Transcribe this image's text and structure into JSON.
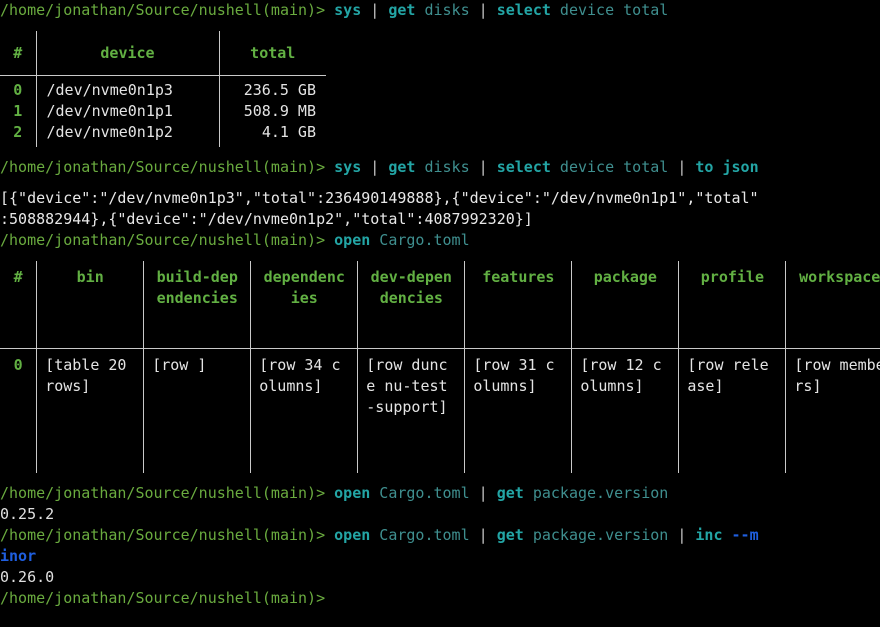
{
  "terminal": {
    "prompt": "/home/jonathan/Source/nushell(main)>",
    "colors": {
      "background": "#000000",
      "prompt_green": "#6aab3f",
      "command_teal": "#23a5a5",
      "argument_dim": "#3f8f8f",
      "flag_blue": "#1f5fe0",
      "table_header_green": "#62b043",
      "output_white": "#e4e4e4",
      "border_gray": "#c9c9c9"
    }
  },
  "blocks": {
    "cmd1": {
      "command": "sys",
      "pipe1": " | ",
      "command2": "get",
      "arg2": " disks",
      "pipe2": " | ",
      "command3": "select",
      "arg3": " device total"
    },
    "cmd2": {
      "command": "sys",
      "pipe1": " | ",
      "command2": "get",
      "arg2": " disks",
      "pipe2": " | ",
      "command3": "select",
      "arg3": " device total",
      "pipe3": " | ",
      "command4": "to json"
    },
    "cmd3": {
      "command": "open",
      "arg": " Cargo.toml"
    },
    "cmd4": {
      "command": "open",
      "arg": " Cargo.toml",
      "pipe1": " | ",
      "command2": "get",
      "arg2": " package.version"
    },
    "cmd5": {
      "command": "open",
      "arg": " Cargo.toml",
      "pipe1": " | ",
      "command2": "get",
      "arg2": " package.version",
      "pipe2": " | ",
      "command3": "inc",
      "flag_head": " --m",
      "flag_wrap": "inor"
    }
  },
  "disks_table": {
    "headers": [
      "#",
      "device",
      "total"
    ],
    "rows": [
      {
        "index": "0",
        "device": "/dev/nvme0n1p3",
        "total": "236.5 GB"
      },
      {
        "index": "1",
        "device": "/dev/nvme0n1p1",
        "total": "508.9 MB"
      },
      {
        "index": "2",
        "device": "/dev/nvme0n1p2",
        "total": "4.1 GB"
      }
    ]
  },
  "json_output": {
    "line1": "[{\"device\":\"/dev/nvme0n1p3\",\"total\":236490149888},{\"device\":\"/dev/nvme0n1p1\",\"total\"",
    "line2": ":508882944},{\"device\":\"/dev/nvme0n1p2\",\"total\":4087992320}]"
  },
  "cargo_table": {
    "headers": [
      "#",
      "bin",
      "build-dependencies",
      "dependencies",
      "dev-dependencies",
      "features",
      "package",
      "profile",
      "workspace"
    ],
    "row": {
      "index": "0",
      "bin": "[table 20 rows]",
      "build_dependencies": "[row ]",
      "dependencies": "[row 34 columns]",
      "dev_dependencies": "[row dunce nu-test-support]",
      "features": "[row 31 columns]",
      "package": "[row 12 columns]",
      "profile": "[row release]",
      "workspace": "[row members]"
    }
  },
  "version_output": {
    "current": "0.25.2",
    "incremented": "0.26.0"
  }
}
